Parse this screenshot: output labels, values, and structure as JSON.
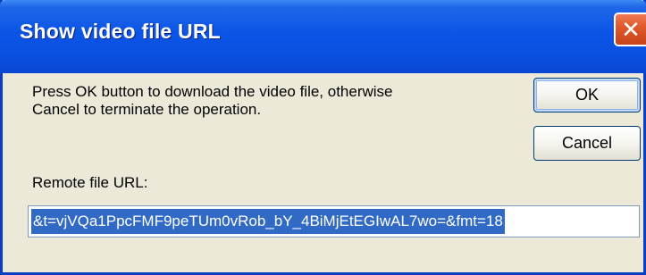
{
  "window": {
    "title": "Show video file URL",
    "close_symbol": "✕",
    "close_icon": "close-icon"
  },
  "message": {
    "line1": "Press OK button to download the video file, otherwise",
    "line2": "Cancel to terminate the operation."
  },
  "buttons": {
    "ok_label": "OK",
    "cancel_label": "Cancel"
  },
  "url": {
    "label": "Remote file URL:",
    "value": "&t=vjVQa1PpcFMF9peTUm0vRob_bY_4BiMjEtEGIwAL7wo=&fmt=18"
  },
  "colors": {
    "titlebar": "#0a4fe0",
    "dialog_bg": "#ece9d8",
    "close_button": "#e05a2c",
    "selection": "#316ac5"
  }
}
